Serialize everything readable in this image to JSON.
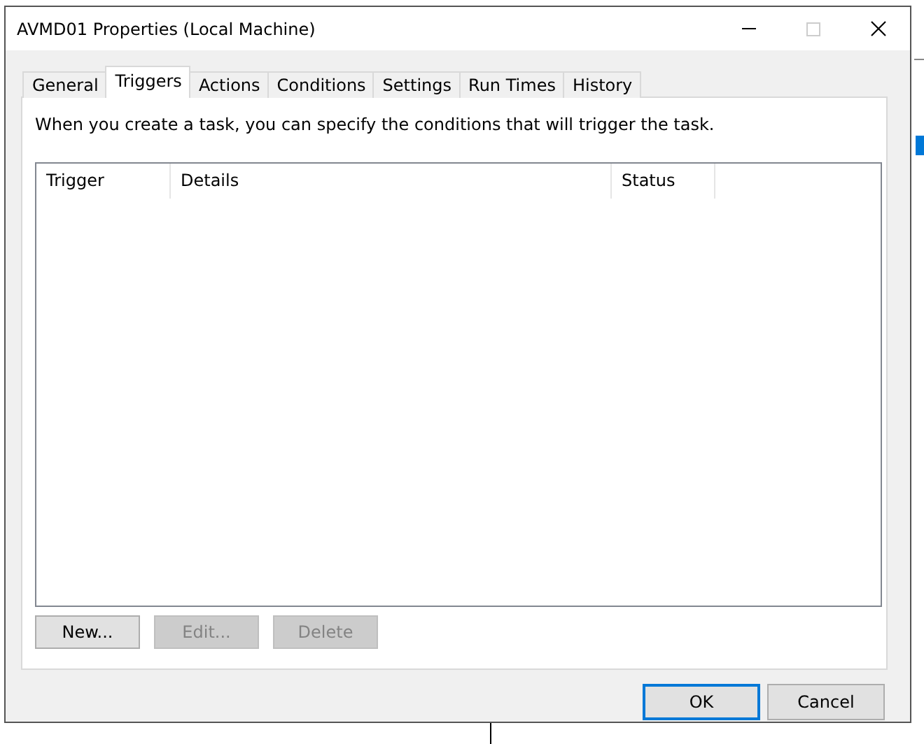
{
  "window": {
    "title": "AVMD01 Properties (Local Machine)"
  },
  "tabs": [
    {
      "label": "General",
      "selected": false
    },
    {
      "label": "Triggers",
      "selected": true
    },
    {
      "label": "Actions",
      "selected": false
    },
    {
      "label": "Conditions",
      "selected": false
    },
    {
      "label": "Settings",
      "selected": false
    },
    {
      "label": "Run Times",
      "selected": false
    },
    {
      "label": "History",
      "selected": false
    }
  ],
  "description": "When you create a task, you can specify the conditions that will trigger the task.",
  "table": {
    "columns": [
      "Trigger",
      "Details",
      "Status"
    ]
  },
  "list_buttons": [
    {
      "label": "New...",
      "disabled": false
    },
    {
      "label": "Edit...",
      "disabled": true
    },
    {
      "label": "Delete",
      "disabled": true
    }
  ],
  "dialog_buttons": [
    {
      "label": "OK",
      "default": true
    },
    {
      "label": "Cancel",
      "default": false
    }
  ]
}
